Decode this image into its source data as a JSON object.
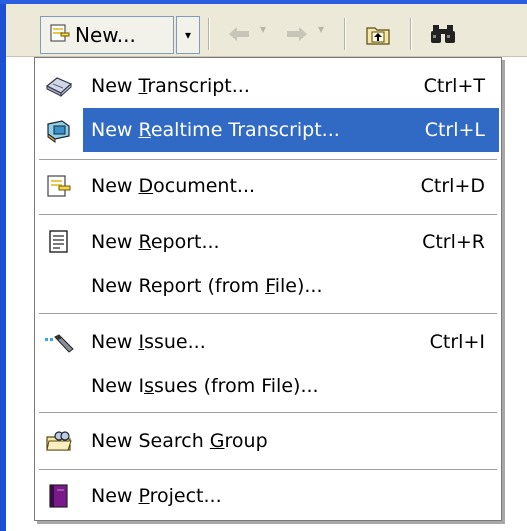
{
  "toolbar": {
    "new_button": {
      "label": "New...",
      "icon": "new-document-icon"
    },
    "dropdown_arrow": "▾",
    "back": {
      "icon": "back-arrow-icon",
      "enabled": false
    },
    "forward": {
      "icon": "forward-arrow-icon",
      "enabled": false
    },
    "up_folder": {
      "icon": "up-folder-icon"
    },
    "find": {
      "icon": "binoculars-icon"
    }
  },
  "menu": {
    "items": [
      {
        "pre": "New ",
        "mn": "T",
        "post": "ranscript...",
        "shortcut": "Ctrl+T",
        "icon": "transcript-icon",
        "highlighted": false
      },
      {
        "pre": "New ",
        "mn": "R",
        "post": "ealtime Transcript...",
        "shortcut": "Ctrl+L",
        "icon": "realtime-transcript-icon",
        "highlighted": true
      },
      {
        "pre": "New ",
        "mn": "D",
        "post": "ocument...",
        "shortcut": "Ctrl+D",
        "icon": "document-icon",
        "highlighted": false
      },
      {
        "pre": "New ",
        "mn": "R",
        "post": "eport...",
        "shortcut": "Ctrl+R",
        "icon": "report-icon",
        "highlighted": false
      },
      {
        "pre": "New Report (from ",
        "mn": "F",
        "post": "ile)...",
        "shortcut": "",
        "icon": "",
        "highlighted": false
      },
      {
        "pre": "New ",
        "mn": "I",
        "post": "ssue...",
        "shortcut": "Ctrl+I",
        "icon": "issue-pen-icon",
        "highlighted": false
      },
      {
        "pre": "New I",
        "mn": "s",
        "post": "sues (from File)...",
        "shortcut": "",
        "icon": "",
        "highlighted": false
      },
      {
        "pre": "New Search ",
        "mn": "G",
        "post": "roup",
        "shortcut": "",
        "icon": "search-group-icon",
        "highlighted": false
      },
      {
        "pre": "New ",
        "mn": "P",
        "post": "roject...",
        "shortcut": "",
        "icon": "project-book-icon",
        "highlighted": false
      }
    ]
  },
  "colors": {
    "highlight": "#316ac5",
    "toolbar_bg": "#ece9d8",
    "window_edge": "#1c4fd2"
  }
}
